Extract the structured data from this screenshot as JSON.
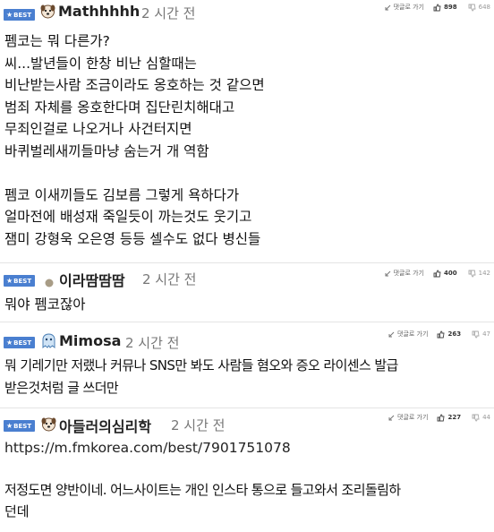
{
  "comments": [
    {
      "badge": "BEST",
      "avatar": "puppy-face-icon",
      "nickname": "Mathhhhh",
      "time": "2 시간 전",
      "reply_label": "댓글로 가기",
      "upvotes": "898",
      "downvotes": "648",
      "lines": [
        "펨코는 뭐 다른가?",
        "씨...발년들이 한창 비난 심할때는",
        "비난받는사람 조금이라도 옹호하는 것 같으면",
        "범죄 자체를 옹호한다며 집단린치해대고",
        "무죄인걸로 나오거나 사건터지면",
        "바퀴벌레새끼들마냥 숨는거 개 역함",
        "",
        "펨코 이새끼들도 김보름 그렇게 욕하다가",
        "얼마전에 배성재 죽일듯이 까는것도 웃기고",
        "잼미 강형욱 오은영 등등 셀수도 없다 병신들"
      ]
    },
    {
      "badge": "BEST",
      "avatar": "gray-dot-icon",
      "nickname": "이라땀땀땀",
      "time": "2 시간 전",
      "reply_label": "댓글로 가기",
      "upvotes": "400",
      "downvotes": "142",
      "lines": [
        "뭐야 펨코잖아"
      ]
    },
    {
      "badge": "BEST",
      "avatar": "blue-ghost-icon",
      "nickname": "Mimosa",
      "time": "2 시간 전",
      "reply_label": "댓글로 가기",
      "upvotes": "263",
      "downvotes": "47",
      "lines": [
        "뭐 기레기만 저랬나 커뮤나 SNS만 봐도 사람들 혐오와 증오 라이센스 발급",
        "받은것처럼 글 쓰더만"
      ]
    },
    {
      "badge": "BEST",
      "avatar": "puppy-face-icon",
      "nickname": "아들러의심리학",
      "time": "2 시간 전",
      "reply_label": "댓글로 가기",
      "upvotes": "227",
      "downvotes": "44",
      "link": "https://m.fmkorea.com/best/7901751078",
      "lines": [
        "저정도면 양반이네. 어느사이트는 개인 인스타 통으로 들고와서 조리돌림하",
        "던데"
      ]
    }
  ],
  "colors": {
    "best_badge": "#4a7fd0",
    "divider": "#e4e4e4",
    "time": "#777777"
  }
}
